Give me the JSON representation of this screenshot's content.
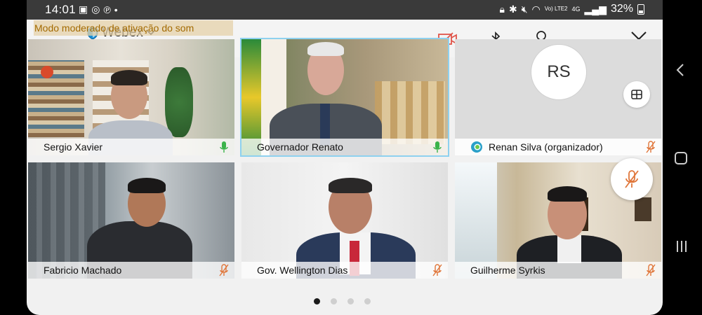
{
  "status_bar": {
    "time": "14:01",
    "network": "4G",
    "lte": "Vo) LTE2",
    "battery": "32%"
  },
  "app": {
    "title": "Webex",
    "moderated_banner": "Modo moderado de ativação do som"
  },
  "participants": [
    {
      "name": "Sergio Xavier",
      "mic": "on"
    },
    {
      "name": "Governador Renato",
      "mic": "on",
      "active_speaker": true
    },
    {
      "name": "Renan Silva (organizador)",
      "mic": "muted",
      "initials": "RS"
    },
    {
      "name": "Fabricio Machado",
      "mic": "muted"
    },
    {
      "name": "Gov. Wellington Dias",
      "mic": "muted"
    },
    {
      "name": "Guilherme Syrkis",
      "mic": "muted"
    }
  ],
  "toolbar": {
    "more": "···"
  },
  "pager": {
    "pages": 4,
    "current": 1
  },
  "colors": {
    "active_outline": "#8ed1ef",
    "mic_on": "#3bb34a",
    "mic_muted": "#e0763a",
    "video_off": "#e0554a",
    "banner_text": "#a36a00"
  }
}
